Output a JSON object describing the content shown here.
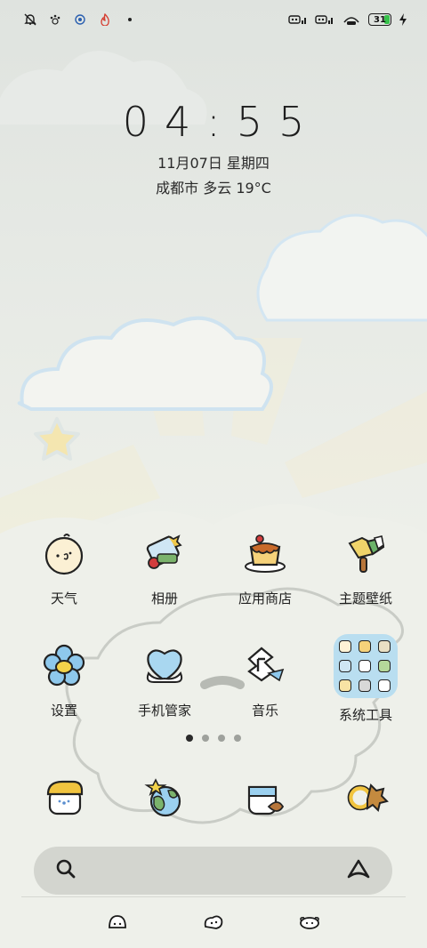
{
  "status_bar": {
    "left_icons": [
      "mute-bell-icon",
      "paw-icon",
      "sync-icon",
      "flame-icon",
      "dot-icon"
    ],
    "right_icons": [
      "signal-1-icon",
      "signal-2-icon",
      "wifi-icon"
    ],
    "battery": {
      "level": "31",
      "percent": 31,
      "charging": true
    }
  },
  "lockclock": {
    "time": "04:55",
    "date": "11月07日 星期四",
    "weather": "成都市 多云 19°C"
  },
  "apps": [
    {
      "label": "天气",
      "icon": "weather-chick-icon"
    },
    {
      "label": "相册",
      "icon": "gallery-icon"
    },
    {
      "label": "应用商店",
      "icon": "app-store-pudding-icon"
    },
    {
      "label": "主题壁纸",
      "icon": "theme-popsicle-icon"
    },
    {
      "label": "设置",
      "icon": "settings-flower-icon"
    },
    {
      "label": "手机管家",
      "icon": "phone-manager-heart-icon"
    },
    {
      "label": "音乐",
      "icon": "music-note-icon"
    },
    {
      "label": "系统工具",
      "icon": "folder-icon"
    }
  ],
  "page_indicator": {
    "count": 4,
    "active": 0
  },
  "dock": [
    {
      "icon": "messages-bread-icon"
    },
    {
      "icon": "browser-globe-icon"
    },
    {
      "icon": "cup-icon"
    },
    {
      "icon": "ring-leaf-icon"
    }
  ],
  "search_bar": {
    "left_icon": "search-icon",
    "right_icon": "assistant-icon"
  },
  "nav_bar": {
    "icons": [
      "nav-menu-icon",
      "nav-home-icon",
      "nav-back-icon"
    ]
  },
  "colors": {
    "folder_bg": "#b9def0",
    "search_bg": "#d3d5cf",
    "battery_fill": "#37c24b"
  }
}
